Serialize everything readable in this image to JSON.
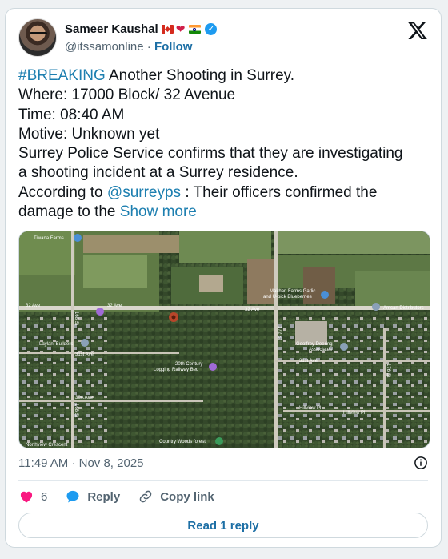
{
  "author": {
    "name": "Sameer Kaushal",
    "handle": "@itssamonline",
    "separator": "·",
    "follow_label": "Follow"
  },
  "tweet": {
    "hashtag": "#BREAKING",
    "line1_rest": " Another Shooting in Surrey.",
    "line2": "Where: 17000 Block/ 32 Avenue",
    "line3": "Time: 08:40 AM",
    "line4": "Motive: Unknown yet",
    "line5": "Surrey Police Service confirms that they are investigating",
    "line6": "a shooting incident at a Surrey residence.",
    "line7_pre": "According to ",
    "mention": "@surreyps",
    "line7_post": " : Their officers confirmed the",
    "line8_pre": "damage to the ",
    "show_more": "Show more"
  },
  "map": {
    "labels": {
      "tiwana": "Tiwana Farms",
      "ave32_left": "32 Ave",
      "ave32_mid": "32 Ave",
      "ave32_right": "32 Ave",
      "makhan": "Makhan Farms Garlic",
      "makhan2": "and U-pick Blueberries",
      "amcan": "Amcan Distributors",
      "laylani": "Laylani Builders",
      "ave31": "31st Ave",
      "ave31_right": "31st Ave",
      "century": "20th Century",
      "century2": "Logging Railway Bed",
      "geoffrey": "Geoffrey Deering",
      "geoffrey2": "Associates",
      "ave30a": "30A Ave",
      "hillview": "Hillview Pl",
      "hillview2": "Hillview Pl",
      "northview": "Northview Crescent",
      "country": "Country Woods forest",
      "st172": "172 St",
      "st168": "168 St",
      "st168b": "168 St",
      "st176": "176 St"
    }
  },
  "meta": {
    "time": "11:49 AM",
    "separator": "·",
    "date": "Nov 8, 2025"
  },
  "actions": {
    "like_count": "6",
    "reply_label": "Reply",
    "copy_label": "Copy link"
  },
  "read_reply_label": "Read 1 reply",
  "icons": {
    "x_logo": "x-logo-icon",
    "verified": "verified-badge-icon",
    "info": "info-icon",
    "heart": "heart-icon",
    "reply": "reply-bubble-icon",
    "link": "link-icon"
  },
  "colors": {
    "link_blue": "#1d7fb0",
    "like_pink": "#f91880",
    "verified_blue": "#1d9bf0"
  }
}
